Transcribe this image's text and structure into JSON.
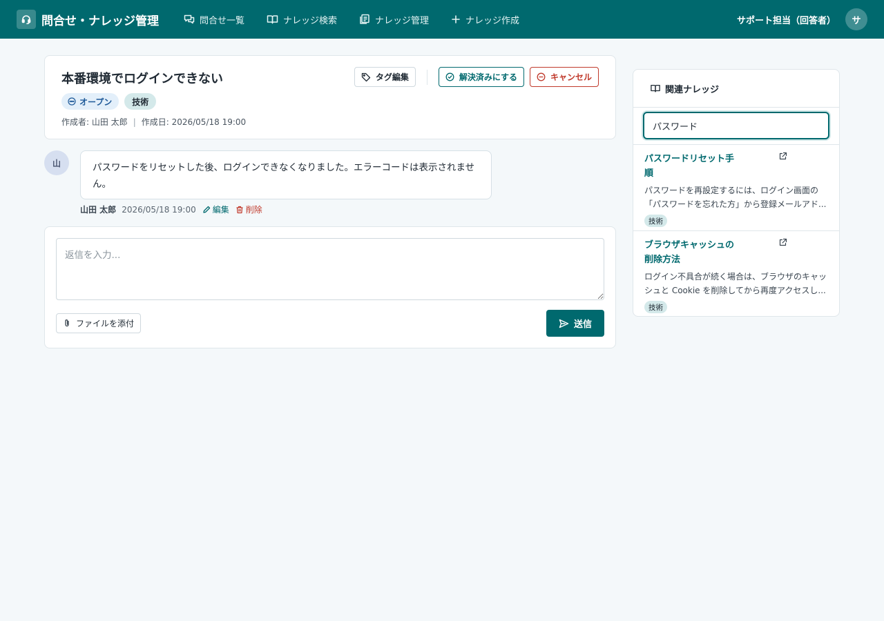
{
  "app": {
    "title": "問合せ・ナレッジ管理",
    "colors": {
      "primary": "#00696e",
      "danger": "#c0392b",
      "status_open": "#1f5a99"
    }
  },
  "nav": {
    "items": [
      {
        "label": "問合せ一覧",
        "icon": "chat-bubbles-icon"
      },
      {
        "label": "ナレッジ検索",
        "icon": "open-book-icon"
      },
      {
        "label": "ナレッジ管理",
        "icon": "documents-icon"
      },
      {
        "label": "ナレッジ作成",
        "icon": "plus-icon"
      }
    ]
  },
  "user": {
    "name": "サポート担当（回答者）",
    "initial": "サ"
  },
  "ticket": {
    "title": "本番環境でログインできない",
    "status": "オープン",
    "tag": "技術",
    "author_meta": "作成者: 山田 太郎",
    "created_meta": "作成日: 2026/05/18 19:00",
    "actions": {
      "tag_edit": "タグ編集",
      "resolve": "解決済みにする",
      "cancel": "キャンセル"
    }
  },
  "message": {
    "avatar_initial": "山",
    "text": "パスワードをリセットした後、ログインできなくなりました。エラーコードは表示されません。",
    "author": "山田 太郎",
    "time": "2026/05/18 19:00",
    "edit_label": "編集",
    "delete_label": "削除"
  },
  "reply": {
    "placeholder": "返信を入力...",
    "attach_label": "ファイルを添付",
    "send_label": "送信"
  },
  "sidebar": {
    "title": "関連ナレッジ",
    "search_value": "パスワード",
    "items": [
      {
        "title_lines": [
          "パスワードリセット手",
          "順"
        ],
        "desc_lines": [
          "パスワードを再設定するには、ログイン画面の",
          "「パスワードを忘れた方」から登録メールアド..."
        ],
        "tag": "技術"
      },
      {
        "title_lines": [
          "ブラウザキャッシュの",
          "削除方法"
        ],
        "desc_lines": [
          "ログイン不具合が続く場合は、ブラウザのキャッ",
          "シュと Cookie を削除してから再度アクセスし..."
        ],
        "tag": "技術"
      }
    ]
  }
}
